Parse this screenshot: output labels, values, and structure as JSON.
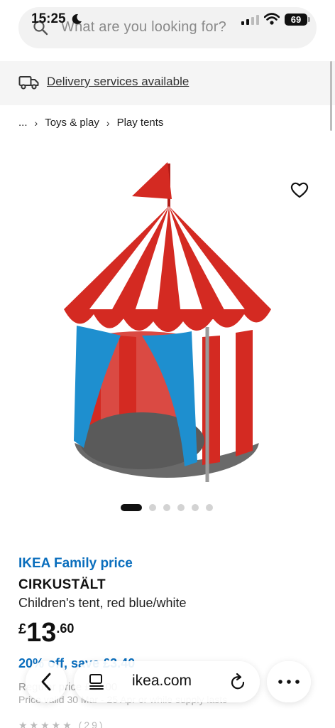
{
  "status_bar": {
    "time": "15:25",
    "battery": "69"
  },
  "search": {
    "placeholder": "What are you looking for?"
  },
  "delivery": {
    "label": "Delivery services available"
  },
  "breadcrumb": {
    "ellipsis": "...",
    "items": [
      "Toys & play",
      "Play tents"
    ]
  },
  "carousel": {
    "total": 6,
    "active": 1
  },
  "product": {
    "family_label": "IKEA Family price",
    "name": "CIRKUSTÄLT",
    "description": "Children's tent, red blue/white",
    "price_currency": "£",
    "price_integer": "13",
    "price_decimal": ".60",
    "discount": "20% off, save £3.40",
    "regular_price": "Regular price £17.00",
    "price_valid": "Price valid 30 Mar - 25 Apr or while supply lasts",
    "rating_count": "(29)"
  },
  "browser": {
    "url": "ikea.com"
  },
  "colors": {
    "family_blue": "#0a6ebd",
    "tent_red": "#d42a22",
    "tent_blue": "#1e8fcf"
  },
  "icons": [
    "search-icon",
    "moon-icon",
    "signal-icon",
    "wifi-icon",
    "truck-icon",
    "heart-icon",
    "chevron-left-icon",
    "tabs-icon",
    "reload-icon",
    "more-icon"
  ]
}
